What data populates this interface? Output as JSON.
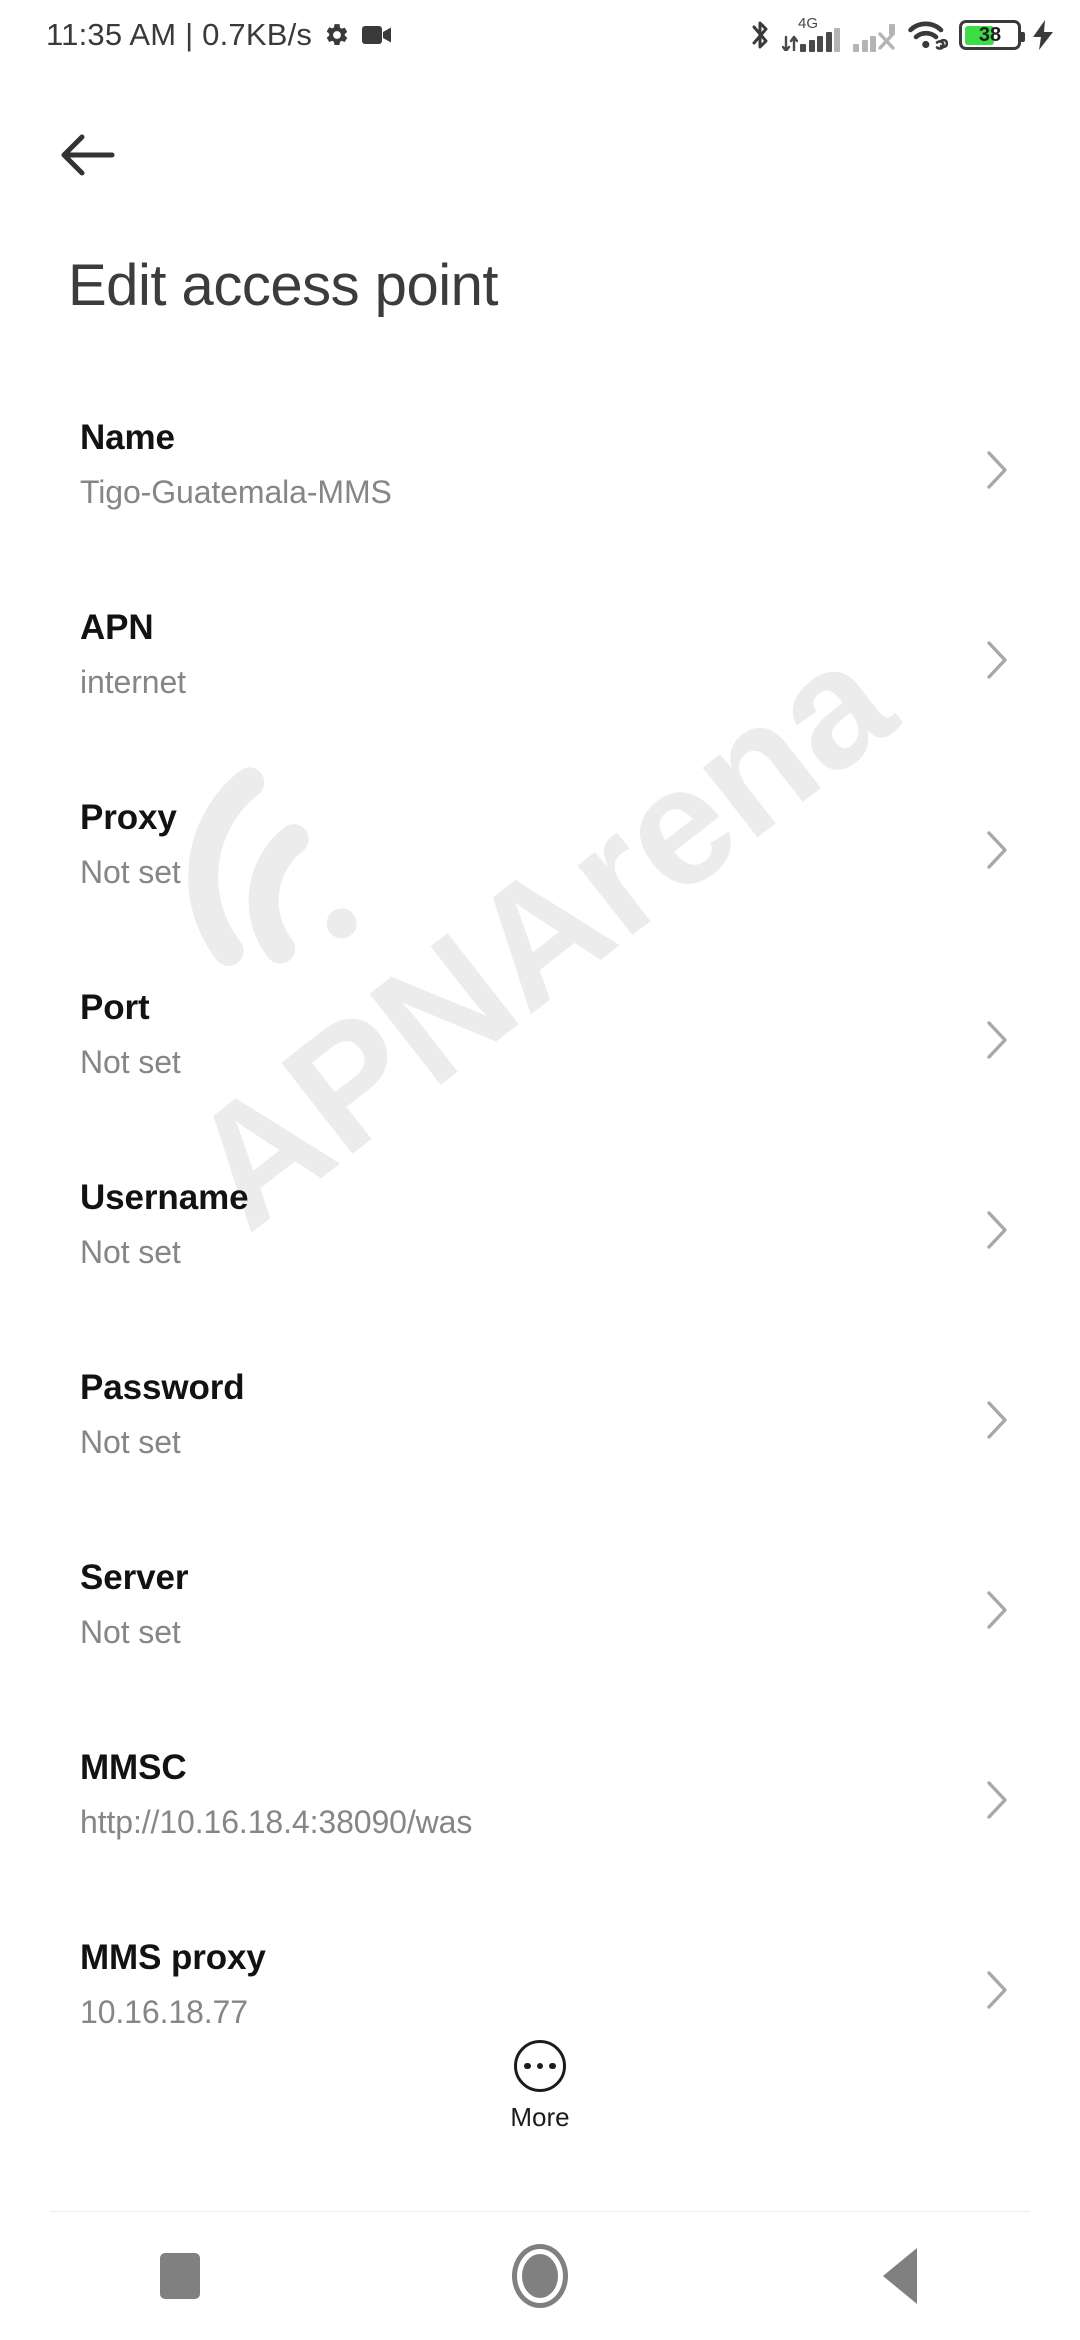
{
  "status_bar": {
    "clock": "11:35 AM | 0.7KB/s",
    "icons": [
      "gear-icon",
      "screen-record-icon",
      "bluetooth-icon",
      "signal-4g-icon",
      "signal-sim2-no-service-icon",
      "wifi-link-icon",
      "battery-icon",
      "charging-bolt-icon"
    ],
    "network_type": "4G",
    "battery_level": "38"
  },
  "app_bar": {
    "back_label": "Back",
    "title": "Edit access point"
  },
  "list": {
    "rows": [
      {
        "title": "Name",
        "value": "Tigo-Guatemala-MMS"
      },
      {
        "title": "APN",
        "value": "internet"
      },
      {
        "title": "Proxy",
        "value": "Not set"
      },
      {
        "title": "Port",
        "value": "Not set"
      },
      {
        "title": "Username",
        "value": "Not set"
      },
      {
        "title": "Password",
        "value": "Not set"
      },
      {
        "title": "Server",
        "value": "Not set"
      },
      {
        "title": "MMSC",
        "value": "http://10.16.18.4:38090/was"
      },
      {
        "title": "MMS proxy",
        "value": "10.16.18.77"
      }
    ]
  },
  "more_button": {
    "label": "More"
  },
  "nav_bar": {
    "recents_label": "Recents",
    "home_label": "Home",
    "back_label": "Back"
  },
  "watermark": {
    "text": "APNArena"
  },
  "colors": {
    "title": "#3c3c3c",
    "row_title": "#121212",
    "row_value": "#868686",
    "chevron": "#a8a8a8",
    "battery_fill": "#3ddc44",
    "nav_icon": "#808080",
    "watermark": "#ececec"
  }
}
